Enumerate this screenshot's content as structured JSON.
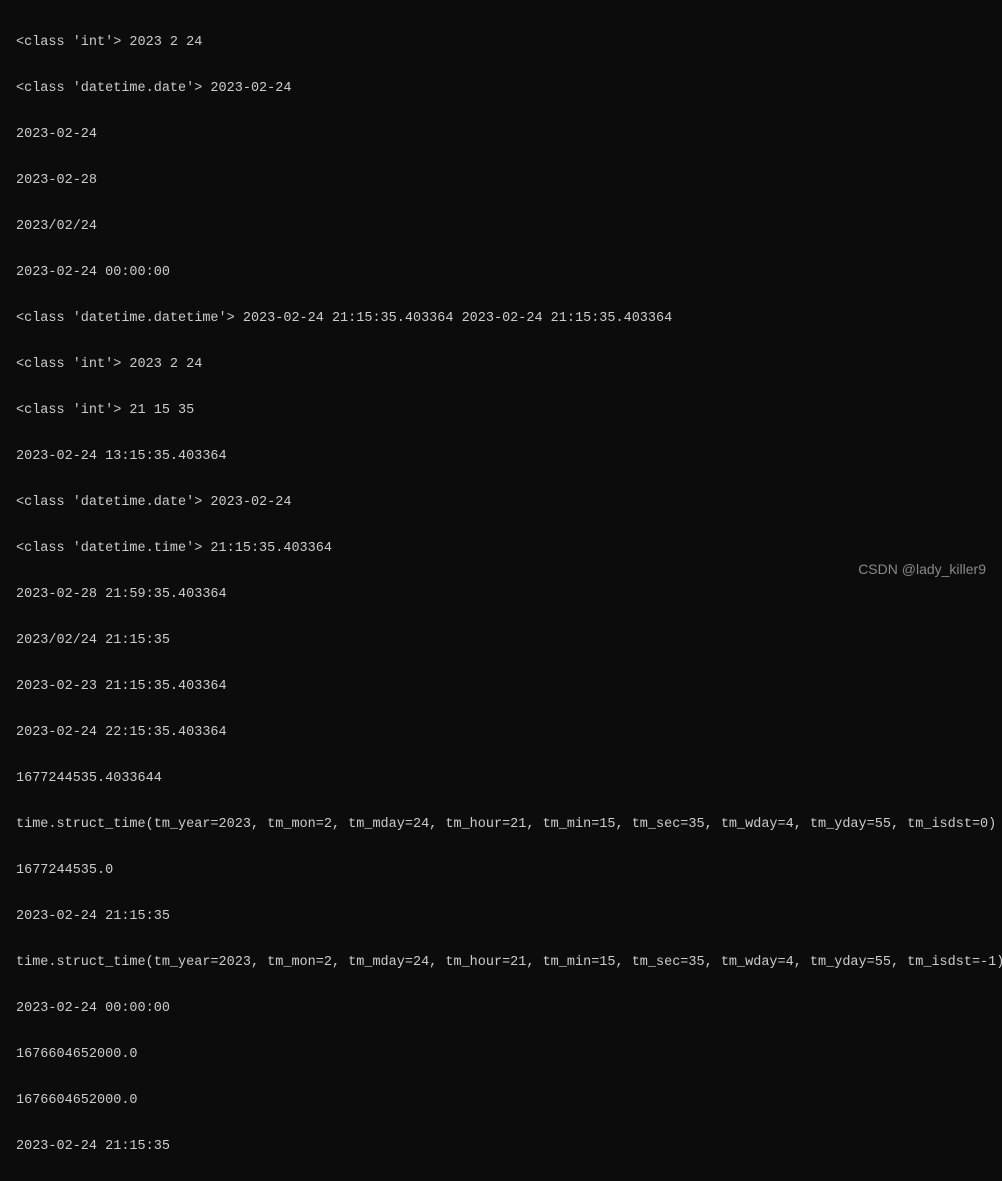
{
  "lines": [
    "<class 'int'> 2023 2 24",
    "<class 'datetime.date'> 2023-02-24",
    "2023-02-24",
    "2023-02-28",
    "2023/02/24",
    "2023-02-24 00:00:00",
    "<class 'datetime.datetime'> 2023-02-24 21:15:35.403364 2023-02-24 21:15:35.403364",
    "<class 'int'> 2023 2 24",
    "<class 'int'> 21 15 35",
    "2023-02-24 13:15:35.403364",
    "<class 'datetime.date'> 2023-02-24",
    "<class 'datetime.time'> 21:15:35.403364",
    "2023-02-28 21:59:35.403364",
    "2023/02/24 21:15:35",
    "2023-02-23 21:15:35.403364",
    "2023-02-24 22:15:35.403364",
    "1677244535.4033644",
    "time.struct_time(tm_year=2023, tm_mon=2, tm_mday=24, tm_hour=21, tm_min=15, tm_sec=35, tm_wday=4, tm_yday=55, tm_isdst=0)",
    "1677244535.0",
    "2023-02-24 21:15:35",
    "time.struct_time(tm_year=2023, tm_mon=2, tm_mday=24, tm_hour=21, tm_min=15, tm_sec=35, tm_wday=4, tm_yday=55, tm_isdst=-1)",
    "2023-02-24 00:00:00",
    "1676604652000.0",
    "1676604652000.0",
    "2023-02-24 21:15:35"
  ],
  "watermark": "CSDN @lady_killer9"
}
